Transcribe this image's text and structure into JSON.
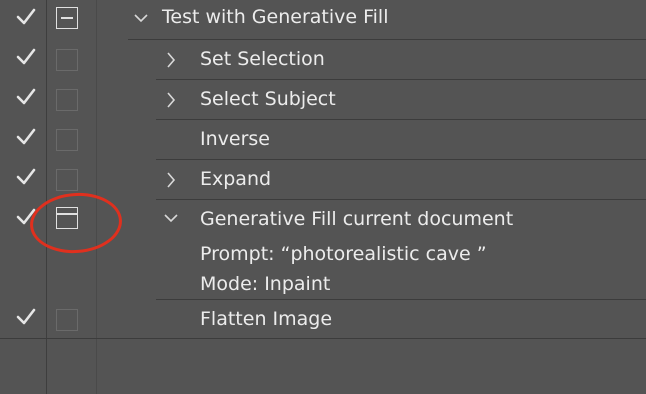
{
  "actions": {
    "parent": {
      "label": "Test with Generative Fill",
      "checked": true
    },
    "steps": [
      {
        "label": "Set Selection",
        "checked": true,
        "expandable": true
      },
      {
        "label": "Select Subject",
        "checked": true,
        "expandable": true
      },
      {
        "label": "Inverse",
        "checked": true,
        "expandable": false
      },
      {
        "label": "Expand",
        "checked": true,
        "expandable": true
      },
      {
        "label": "Generative Fill current document",
        "checked": true,
        "expanded": true,
        "details": [
          "Prompt:  “photorealistic cave ”",
          "Mode: Inpaint"
        ]
      },
      {
        "label": "Flatten Image",
        "checked": true,
        "expandable": false
      }
    ]
  },
  "icons": {
    "check": "checkmark-icon",
    "dialog_toggle": "dialog-toggle-icon",
    "chevron_right": "chevron-right-icon",
    "chevron_down": "chevron-down-icon"
  },
  "colors": {
    "background": "#545454",
    "highlight_circle": "#e0301e",
    "text": "#ececec"
  }
}
